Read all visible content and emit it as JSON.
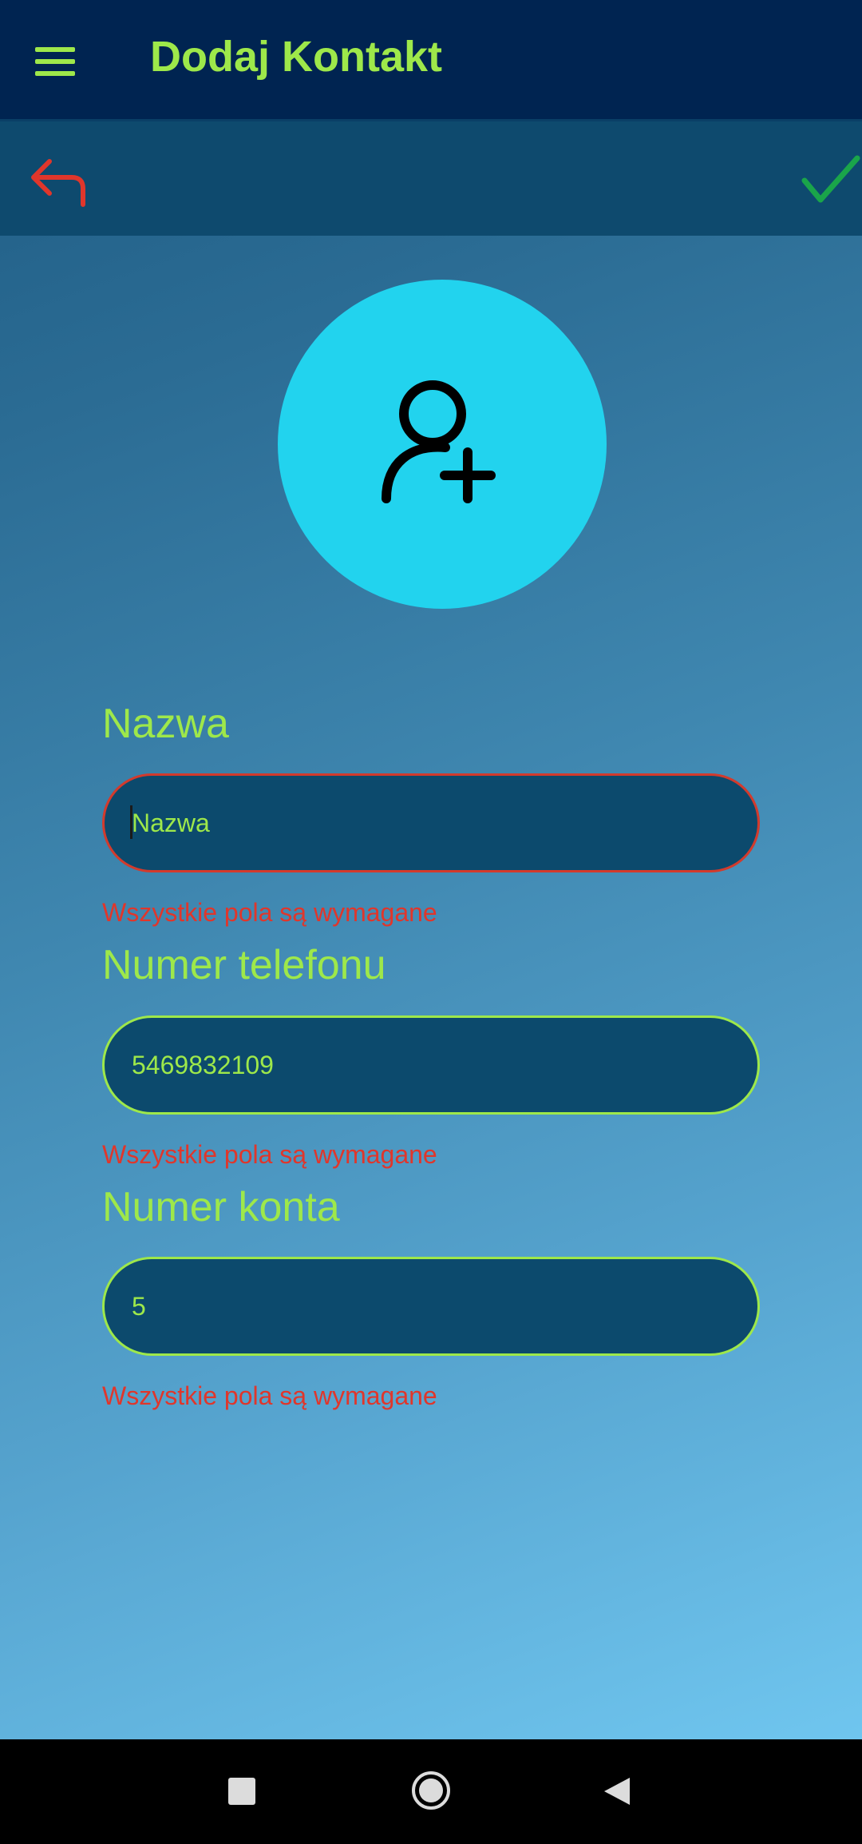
{
  "app_bar": {
    "title": "Dodaj Kontakt",
    "menu_icon": "hamburger-menu-icon"
  },
  "action_bar": {
    "back_icon": "undo-arrow-icon",
    "save_icon": "checkmark-icon"
  },
  "avatar": {
    "icon": "person-add-icon"
  },
  "form": {
    "fields": [
      {
        "label": "Nazwa",
        "value": "",
        "placeholder": "Nazwa",
        "error": "Wszystkie pola są wymagane",
        "border_color": "#d33a2c"
      },
      {
        "label": "Numer telefonu",
        "value": "5469832109",
        "placeholder": "",
        "error": "Wszystkie pola są wymagane",
        "border_color": "#9ee84a"
      },
      {
        "label": "Numer konta",
        "value": "5",
        "placeholder": "",
        "error": "Wszystkie pola są wymagane",
        "border_color": "#9ee84a"
      }
    ]
  },
  "system_nav": {
    "buttons": [
      "recents-square-icon",
      "home-circle-icon",
      "back-triangle-icon"
    ]
  },
  "colors": {
    "accent": "#9ee84a",
    "error": "#e0362b",
    "app_bar": "#002451",
    "avatar": "#22d3ee",
    "save": "#1aa54a"
  }
}
